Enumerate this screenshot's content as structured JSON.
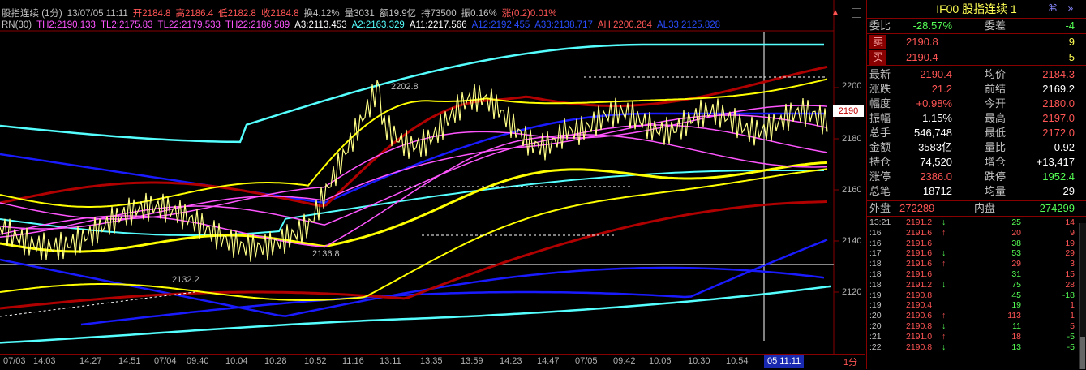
{
  "header": {
    "line1": [
      {
        "text": "股指连续 (1分)",
        "color": "#c0c0c0"
      },
      {
        "text": "13/07/05 11:11",
        "color": "#c0c0c0"
      },
      {
        "text": "开2184.8",
        "color": "#ff5555"
      },
      {
        "text": "高2186.4",
        "color": "#ff5555"
      },
      {
        "text": "低2182.8",
        "color": "#ff5555"
      },
      {
        "text": "收2184.8",
        "color": "#ff5555"
      },
      {
        "text": "换4.12%",
        "color": "#c0c0c0"
      },
      {
        "text": "量3031",
        "color": "#c0c0c0"
      },
      {
        "text": "额19.9亿",
        "color": "#c0c0c0"
      },
      {
        "text": "持73500",
        "color": "#c0c0c0"
      },
      {
        "text": "振0.16%",
        "color": "#c0c0c0"
      },
      {
        "text": "涨(0.2)0.01%",
        "color": "#ff5555"
      }
    ],
    "line2": [
      {
        "text": "RN(30)",
        "color": "#c0c0c0"
      },
      {
        "text": "TH2:2190.133",
        "color": "#ff55ff"
      },
      {
        "text": "TL2:2175.83",
        "color": "#ff55ff"
      },
      {
        "text": "TL22:2179.533",
        "color": "#ff55ff"
      },
      {
        "text": "TH22:2186.589",
        "color": "#ff55ff"
      },
      {
        "text": "A3:2113.453",
        "color": "#ffffff"
      },
      {
        "text": "A2:2163.329",
        "color": "#55ffff"
      },
      {
        "text": "A11:2217.566",
        "color": "#ffffff"
      },
      {
        "text": "A12:2192.455",
        "color": "#2a4dff"
      },
      {
        "text": "A33:2138.717",
        "color": "#2a4dff"
      },
      {
        "text": "AH:2200.284",
        "color": "#ff5555"
      },
      {
        "text": "AL33:2125.828",
        "color": "#2a4dff"
      }
    ]
  },
  "price_axis": {
    "labels": [
      "2200",
      "2180",
      "2160",
      "2140",
      "2120"
    ],
    "current_price_tag": "2190"
  },
  "time_axis": {
    "labels": [
      "07/03",
      "14:03",
      "14:27",
      "14:51",
      "07/04",
      "09:40",
      "10:04",
      "10:28",
      "10:52",
      "11:16",
      "13:11",
      "13:35",
      "13:59",
      "14:23",
      "14:47",
      "07/05",
      "09:42",
      "10:06",
      "10:30",
      "10:54"
    ],
    "cursor_label": "05 11:11",
    "period_label": "1分"
  },
  "annotations": {
    "high": "2202.8",
    "mid_low": "2136.8",
    "low": "2132.2"
  },
  "quote_panel": {
    "title": "IF00  股指连续  1",
    "weibi_label": "委比",
    "weibi_value": "-28.57%",
    "weicha_label": "委差",
    "weicha_value": "-4",
    "sell_label": "卖",
    "sell_price": "2190.8",
    "sell_qty": "9",
    "buy_label": "买",
    "buy_price": "2190.4",
    "buy_qty": "5",
    "rows": [
      {
        "l1": "最新",
        "v1": "2190.4",
        "c1": "#ff5555",
        "l2": "均价",
        "v2": "2184.3",
        "c2": "#ff5555"
      },
      {
        "l1": "涨跌",
        "v1": "21.2",
        "c1": "#ff5555",
        "l2": "前结",
        "v2": "2169.2",
        "c2": "#ffffff"
      },
      {
        "l1": "幅度",
        "v1": "+0.98%",
        "c1": "#ff5555",
        "l2": "今开",
        "v2": "2180.0",
        "c2": "#ff5555"
      },
      {
        "l1": "振幅",
        "v1": "1.15%",
        "c1": "#ffffff",
        "l2": "最高",
        "v2": "2197.0",
        "c2": "#ff5555"
      },
      {
        "l1": "总手",
        "v1": "546,748",
        "c1": "#ffffff",
        "l2": "最低",
        "v2": "2172.0",
        "c2": "#ff5555"
      },
      {
        "l1": "金额",
        "v1": "3583亿",
        "c1": "#ffffff",
        "l2": "量比",
        "v2": "0.92",
        "c2": "#ffffff"
      },
      {
        "l1": "持仓",
        "v1": "74,520",
        "c1": "#ffffff",
        "l2": "增仓",
        "v2": "+13,417",
        "c2": "#ffffff"
      },
      {
        "l1": "涨停",
        "v1": "2386.0",
        "c1": "#ff5555",
        "l2": "跌停",
        "v2": "1952.4",
        "c2": "#55ff55"
      },
      {
        "l1": "总笔",
        "v1": "18712",
        "c1": "#ffffff",
        "l2": "均量",
        "v2": "29",
        "c2": "#ffffff"
      }
    ],
    "outer_label": "外盘",
    "outer_value": "272289",
    "inner_label": "内盘",
    "inner_value": "274299",
    "ticks": [
      {
        "time": "13:21",
        "price": "2191.2",
        "dir": "↓",
        "vol": "25",
        "chg": "14"
      },
      {
        "time": ":16",
        "price": "2191.6",
        "dir": "↑",
        "vol": "20",
        "chg": "9"
      },
      {
        "time": ":16",
        "price": "2191.6",
        "dir": "",
        "vol": "38",
        "chg": "19"
      },
      {
        "time": ":17",
        "price": "2191.6",
        "dir": "↓",
        "vol": "53",
        "chg": "29"
      },
      {
        "time": ":18",
        "price": "2191.6",
        "dir": "↑",
        "vol": "29",
        "chg": "3"
      },
      {
        "time": ":18",
        "price": "2191.6",
        "dir": "",
        "vol": "31",
        "chg": "15"
      },
      {
        "time": ":18",
        "price": "2191.2",
        "dir": "↓",
        "vol": "75",
        "chg": "28"
      },
      {
        "time": ":19",
        "price": "2190.8",
        "dir": "",
        "vol": "45",
        "chg": "-18"
      },
      {
        "time": ":19",
        "price": "2190.4",
        "dir": "",
        "vol": "19",
        "chg": "1"
      },
      {
        "time": ":20",
        "price": "2190.6",
        "dir": "↑",
        "vol": "113",
        "chg": "1"
      },
      {
        "time": ":20",
        "price": "2190.8",
        "dir": "↓",
        "vol": "11",
        "chg": "5"
      },
      {
        "time": ":21",
        "price": "2191.0",
        "dir": "↑",
        "vol": "18",
        "chg": "-5"
      },
      {
        "time": ":22",
        "price": "2190.8",
        "dir": "↓",
        "vol": "13",
        "chg": "-5"
      }
    ]
  },
  "colors": {
    "up": "#ff5555",
    "down": "#55ff55",
    "grid": "#880000",
    "yellow": "#ffff00",
    "cyan": "#55ffff",
    "blue": "#1a1aff",
    "magenta": "#ff55ff",
    "darkred": "#b00000",
    "white": "#ffffff"
  }
}
